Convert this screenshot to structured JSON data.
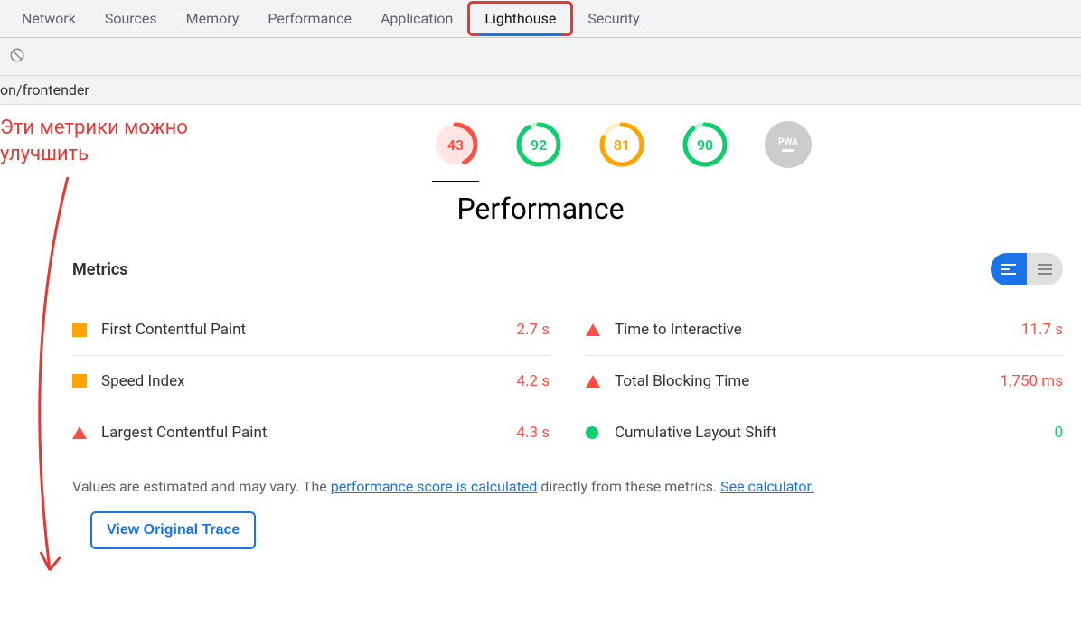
{
  "tabs": [
    "Network",
    "Sources",
    "Memory",
    "Performance",
    "Application",
    "Lighthouse",
    "Security"
  ],
  "active_tab_index": 5,
  "url_fragment": "on/frontender",
  "annotation": "Эти метрики можно улучшить",
  "gauges": [
    {
      "value": "43",
      "color": "red",
      "percent": 43
    },
    {
      "value": "92",
      "color": "green",
      "percent": 92
    },
    {
      "value": "81",
      "color": "orange",
      "percent": 81
    },
    {
      "value": "90",
      "color": "green",
      "percent": 90
    }
  ],
  "pwa_label": "PWA",
  "section_title": "Performance",
  "metrics_heading": "Metrics",
  "metrics": {
    "left": [
      {
        "icon": "square-orange",
        "label": "First Contentful Paint",
        "value": "2.7 s",
        "vclass": "val-orange"
      },
      {
        "icon": "square-orange",
        "label": "Speed Index",
        "value": "4.2 s",
        "vclass": "val-orange"
      },
      {
        "icon": "triangle-red",
        "label": "Largest Contentful Paint",
        "value": "4.3 s",
        "vclass": "val-red"
      }
    ],
    "right": [
      {
        "icon": "triangle-red",
        "label": "Time to Interactive",
        "value": "11.7 s",
        "vclass": "val-red"
      },
      {
        "icon": "triangle-red",
        "label": "Total Blocking Time",
        "value": "1,750 ms",
        "vclass": "val-red"
      },
      {
        "icon": "circle-green",
        "label": "Cumulative Layout Shift",
        "value": "0",
        "vclass": "val-green"
      }
    ]
  },
  "footnote_prefix": "Values are estimated and may vary. The ",
  "footnote_link1": "performance score is calculated",
  "footnote_mid": " directly from these metrics. ",
  "footnote_link2": "See calculator.",
  "trace_button": "View Original Trace"
}
